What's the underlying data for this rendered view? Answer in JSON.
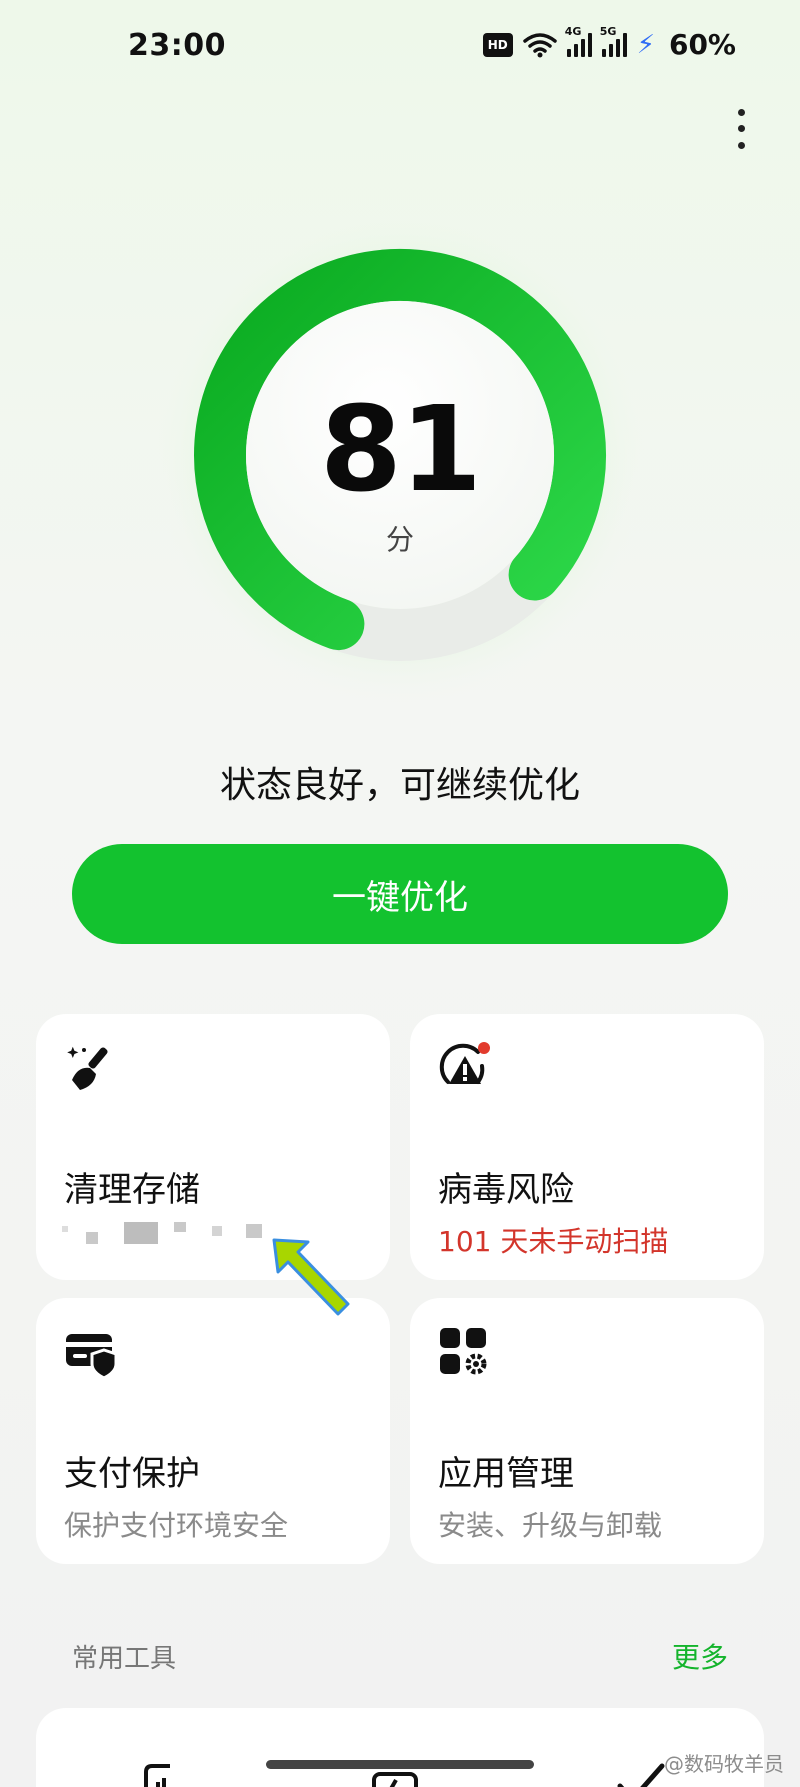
{
  "status_bar": {
    "time": "23:00",
    "hd_badge": "HD",
    "network_1": "4G",
    "network_2": "5G",
    "battery": "60%",
    "icons": [
      "wifi-icon",
      "signal-icon",
      "charging-icon"
    ]
  },
  "gauge": {
    "score": "81",
    "unit": "分",
    "fill_fraction": 0.81,
    "colors": {
      "arc_dark": "#0aaa20",
      "arc_light": "#2ed94a",
      "center": "#ffffff"
    }
  },
  "status_message": "状态良好，可继续优化",
  "optimize_button": {
    "label": "一键优化",
    "color": "#13c22f"
  },
  "cards": [
    {
      "title": "清理存储",
      "subtitle": "",
      "icon": "broom-sparkle-icon"
    },
    {
      "title": "病毒风险",
      "subtitle": "101 天未手动扫描",
      "icon": "virus-alert-icon",
      "badge_color": "#e23b2d",
      "subtitle_color": "#d3352b"
    },
    {
      "title": "支付保护",
      "subtitle": "保护支付环境安全",
      "icon": "card-shield-icon"
    },
    {
      "title": "应用管理",
      "subtitle": "安装、升级与卸载",
      "icon": "apps-gear-icon"
    }
  ],
  "tools_section": {
    "label": "常用工具",
    "more": "更多"
  },
  "watermark": "@数码牧羊员"
}
